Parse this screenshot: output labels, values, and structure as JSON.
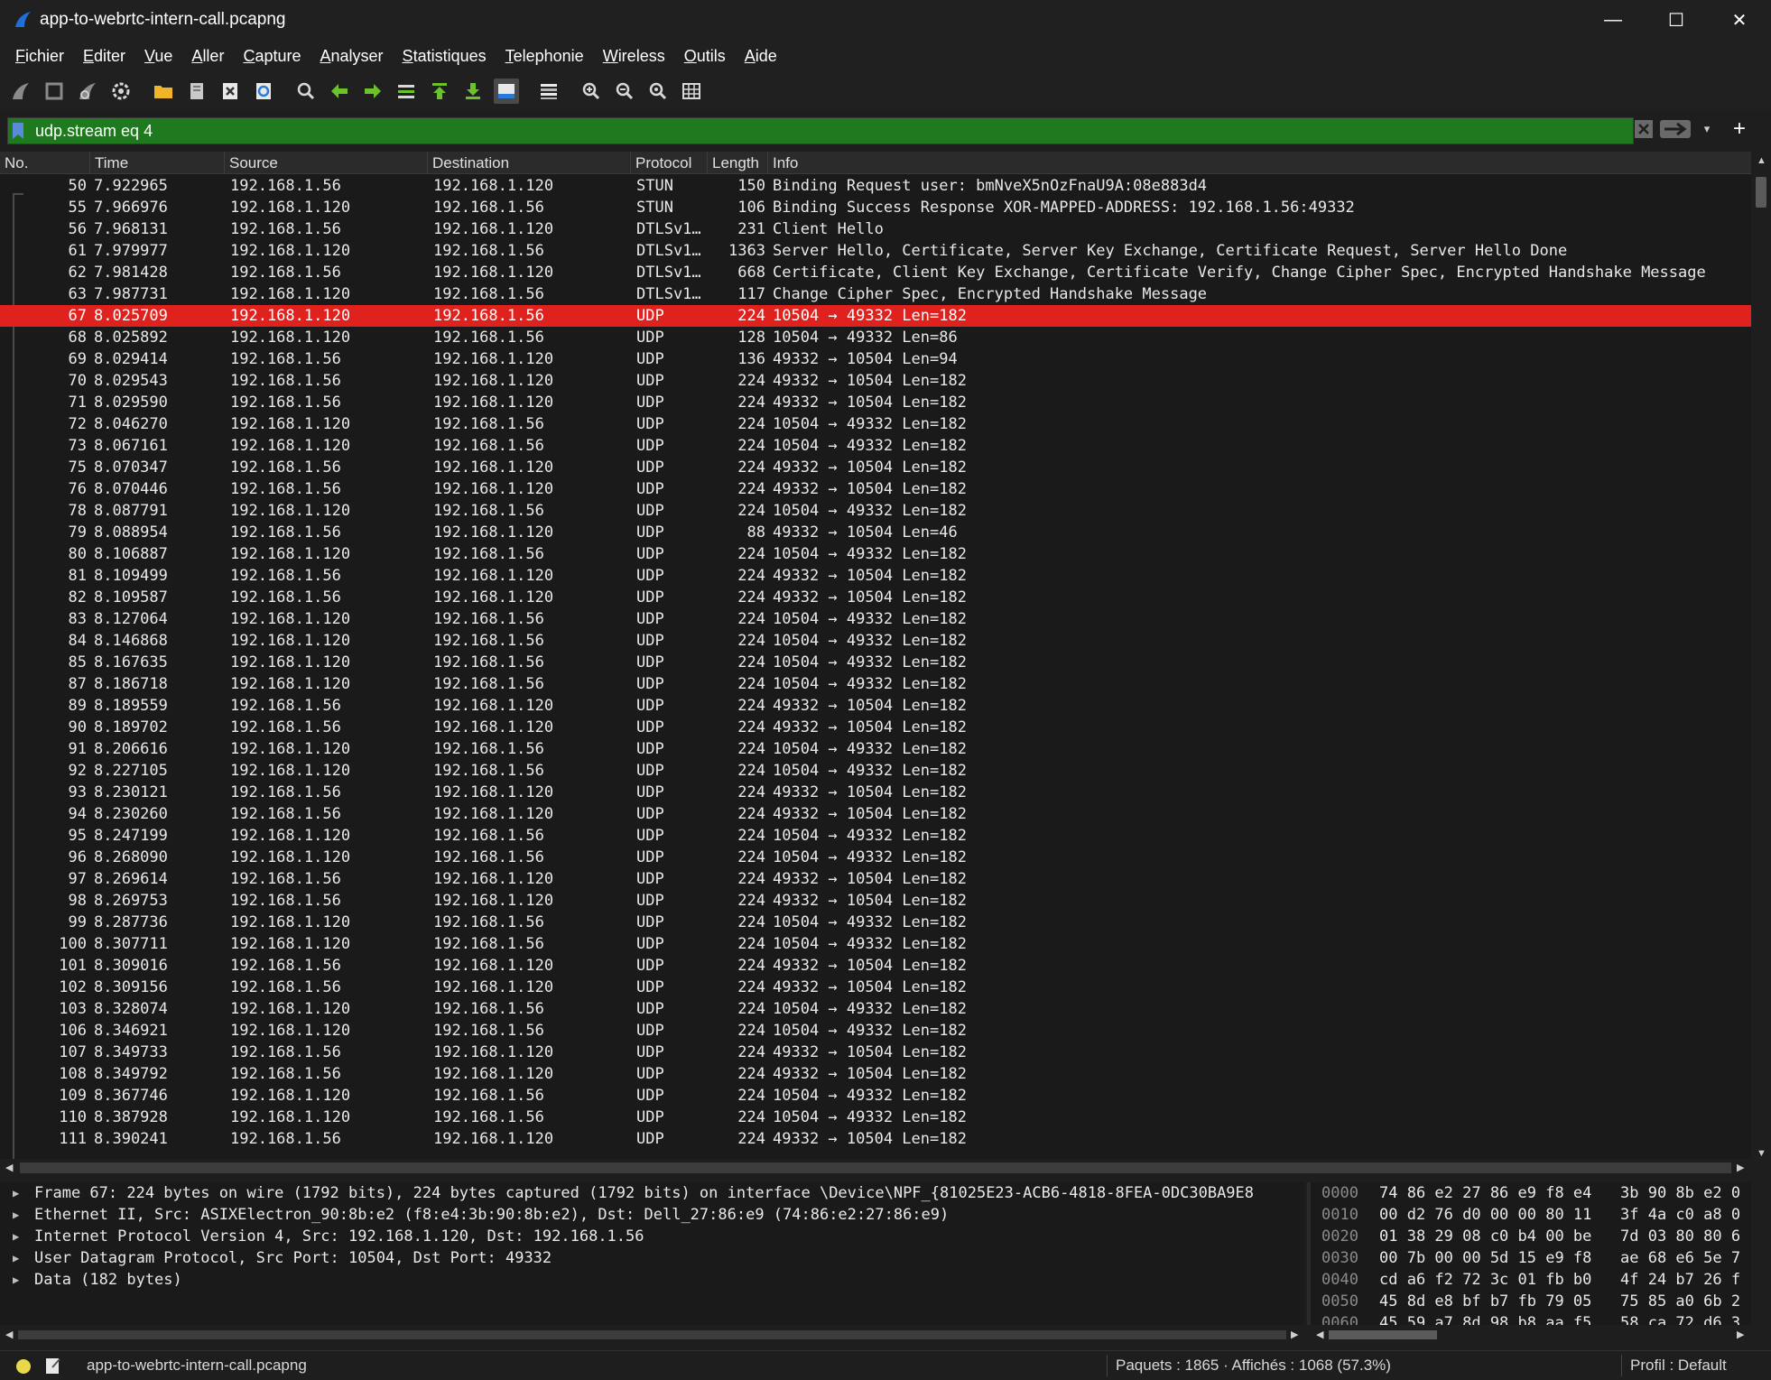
{
  "window": {
    "title": "app-to-webrtc-intern-call.pcapng",
    "controls": {
      "minimize": "—",
      "maximize": "☐",
      "close": "✕"
    }
  },
  "menu": [
    {
      "first": "F",
      "rest": "ichier"
    },
    {
      "first": "E",
      "rest": "diter"
    },
    {
      "first": "V",
      "rest": "ue"
    },
    {
      "first": "A",
      "rest": "ller"
    },
    {
      "first": "C",
      "rest": "apture"
    },
    {
      "first": "A",
      "rest": "nalyser"
    },
    {
      "first": "S",
      "rest": "tatistiques"
    },
    {
      "first": "T",
      "rest": "elephonie"
    },
    {
      "first": "W",
      "rest": "ireless"
    },
    {
      "first": "O",
      "rest": "utils"
    },
    {
      "first": "A",
      "rest": "ide"
    }
  ],
  "toolbar": [
    "shark-fin-start-icon",
    "stop-square-icon",
    "shark-fin-restart-icon",
    "capture-options-gear-icon",
    "open-folder-icon",
    "file-save-icon",
    "close-file-icon",
    "reload-icon",
    "find-packet-icon",
    "go-back-icon",
    "go-forward-icon",
    "go-to-packet-icon",
    "first-packet-icon",
    "last-packet-icon",
    "autoscroll-icon",
    "colorize-icon",
    "zoom-in-icon",
    "zoom-out-icon",
    "zoom-normal-icon",
    "resize-columns-icon"
  ],
  "filter": {
    "value": "udp.stream eq 4",
    "bg": "#1f7a1f",
    "add_label": "+",
    "drop_label": "▾"
  },
  "columns": [
    "No.",
    "Time",
    "Source",
    "Destination",
    "Protocol",
    "Length",
    "Info"
  ],
  "packets": [
    {
      "no": "50",
      "time": "7.922965",
      "src": "192.168.1.56",
      "dst": "192.168.1.120",
      "proto": "STUN",
      "len": "150",
      "info": "Binding Request user: bmNveX5nOzFnaU9A:08e883d4"
    },
    {
      "no": "55",
      "time": "7.966976",
      "src": "192.168.1.120",
      "dst": "192.168.1.56",
      "proto": "STUN",
      "len": "106",
      "info": "Binding Success Response XOR-MAPPED-ADDRESS: 192.168.1.56:49332"
    },
    {
      "no": "56",
      "time": "7.968131",
      "src": "192.168.1.56",
      "dst": "192.168.1.120",
      "proto": "DTLSv1…",
      "len": "231",
      "info": "Client Hello"
    },
    {
      "no": "61",
      "time": "7.979977",
      "src": "192.168.1.120",
      "dst": "192.168.1.56",
      "proto": "DTLSv1…",
      "len": "1363",
      "info": "Server Hello, Certificate, Server Key Exchange, Certificate Request, Server Hello Done"
    },
    {
      "no": "62",
      "time": "7.981428",
      "src": "192.168.1.56",
      "dst": "192.168.1.120",
      "proto": "DTLSv1…",
      "len": "668",
      "info": "Certificate, Client Key Exchange, Certificate Verify, Change Cipher Spec, Encrypted Handshake Message"
    },
    {
      "no": "63",
      "time": "7.987731",
      "src": "192.168.1.120",
      "dst": "192.168.1.56",
      "proto": "DTLSv1…",
      "len": "117",
      "info": "Change Cipher Spec, Encrypted Handshake Message"
    },
    {
      "no": "67",
      "time": "8.025709",
      "src": "192.168.1.120",
      "dst": "192.168.1.56",
      "proto": "UDP",
      "len": "224",
      "info": "10504 → 49332 Len=182",
      "selected": true
    },
    {
      "no": "68",
      "time": "8.025892",
      "src": "192.168.1.120",
      "dst": "192.168.1.56",
      "proto": "UDP",
      "len": "128",
      "info": "10504 → 49332 Len=86"
    },
    {
      "no": "69",
      "time": "8.029414",
      "src": "192.168.1.56",
      "dst": "192.168.1.120",
      "proto": "UDP",
      "len": "136",
      "info": "49332 → 10504 Len=94"
    },
    {
      "no": "70",
      "time": "8.029543",
      "src": "192.168.1.56",
      "dst": "192.168.1.120",
      "proto": "UDP",
      "len": "224",
      "info": "49332 → 10504 Len=182"
    },
    {
      "no": "71",
      "time": "8.029590",
      "src": "192.168.1.56",
      "dst": "192.168.1.120",
      "proto": "UDP",
      "len": "224",
      "info": "49332 → 10504 Len=182"
    },
    {
      "no": "72",
      "time": "8.046270",
      "src": "192.168.1.120",
      "dst": "192.168.1.56",
      "proto": "UDP",
      "len": "224",
      "info": "10504 → 49332 Len=182"
    },
    {
      "no": "73",
      "time": "8.067161",
      "src": "192.168.1.120",
      "dst": "192.168.1.56",
      "proto": "UDP",
      "len": "224",
      "info": "10504 → 49332 Len=182"
    },
    {
      "no": "75",
      "time": "8.070347",
      "src": "192.168.1.56",
      "dst": "192.168.1.120",
      "proto": "UDP",
      "len": "224",
      "info": "49332 → 10504 Len=182"
    },
    {
      "no": "76",
      "time": "8.070446",
      "src": "192.168.1.56",
      "dst": "192.168.1.120",
      "proto": "UDP",
      "len": "224",
      "info": "49332 → 10504 Len=182"
    },
    {
      "no": "78",
      "time": "8.087791",
      "src": "192.168.1.120",
      "dst": "192.168.1.56",
      "proto": "UDP",
      "len": "224",
      "info": "10504 → 49332 Len=182"
    },
    {
      "no": "79",
      "time": "8.088954",
      "src": "192.168.1.56",
      "dst": "192.168.1.120",
      "proto": "UDP",
      "len": "88",
      "info": "49332 → 10504 Len=46"
    },
    {
      "no": "80",
      "time": "8.106887",
      "src": "192.168.1.120",
      "dst": "192.168.1.56",
      "proto": "UDP",
      "len": "224",
      "info": "10504 → 49332 Len=182"
    },
    {
      "no": "81",
      "time": "8.109499",
      "src": "192.168.1.56",
      "dst": "192.168.1.120",
      "proto": "UDP",
      "len": "224",
      "info": "49332 → 10504 Len=182"
    },
    {
      "no": "82",
      "time": "8.109587",
      "src": "192.168.1.56",
      "dst": "192.168.1.120",
      "proto": "UDP",
      "len": "224",
      "info": "49332 → 10504 Len=182"
    },
    {
      "no": "83",
      "time": "8.127064",
      "src": "192.168.1.120",
      "dst": "192.168.1.56",
      "proto": "UDP",
      "len": "224",
      "info": "10504 → 49332 Len=182"
    },
    {
      "no": "84",
      "time": "8.146868",
      "src": "192.168.1.120",
      "dst": "192.168.1.56",
      "proto": "UDP",
      "len": "224",
      "info": "10504 → 49332 Len=182"
    },
    {
      "no": "85",
      "time": "8.167635",
      "src": "192.168.1.120",
      "dst": "192.168.1.56",
      "proto": "UDP",
      "len": "224",
      "info": "10504 → 49332 Len=182"
    },
    {
      "no": "87",
      "time": "8.186718",
      "src": "192.168.1.120",
      "dst": "192.168.1.56",
      "proto": "UDP",
      "len": "224",
      "info": "10504 → 49332 Len=182"
    },
    {
      "no": "89",
      "time": "8.189559",
      "src": "192.168.1.56",
      "dst": "192.168.1.120",
      "proto": "UDP",
      "len": "224",
      "info": "49332 → 10504 Len=182"
    },
    {
      "no": "90",
      "time": "8.189702",
      "src": "192.168.1.56",
      "dst": "192.168.1.120",
      "proto": "UDP",
      "len": "224",
      "info": "49332 → 10504 Len=182"
    },
    {
      "no": "91",
      "time": "8.206616",
      "src": "192.168.1.120",
      "dst": "192.168.1.56",
      "proto": "UDP",
      "len": "224",
      "info": "10504 → 49332 Len=182"
    },
    {
      "no": "92",
      "time": "8.227105",
      "src": "192.168.1.120",
      "dst": "192.168.1.56",
      "proto": "UDP",
      "len": "224",
      "info": "10504 → 49332 Len=182"
    },
    {
      "no": "93",
      "time": "8.230121",
      "src": "192.168.1.56",
      "dst": "192.168.1.120",
      "proto": "UDP",
      "len": "224",
      "info": "49332 → 10504 Len=182"
    },
    {
      "no": "94",
      "time": "8.230260",
      "src": "192.168.1.56",
      "dst": "192.168.1.120",
      "proto": "UDP",
      "len": "224",
      "info": "49332 → 10504 Len=182"
    },
    {
      "no": "95",
      "time": "8.247199",
      "src": "192.168.1.120",
      "dst": "192.168.1.56",
      "proto": "UDP",
      "len": "224",
      "info": "10504 → 49332 Len=182"
    },
    {
      "no": "96",
      "time": "8.268090",
      "src": "192.168.1.120",
      "dst": "192.168.1.56",
      "proto": "UDP",
      "len": "224",
      "info": "10504 → 49332 Len=182"
    },
    {
      "no": "97",
      "time": "8.269614",
      "src": "192.168.1.56",
      "dst": "192.168.1.120",
      "proto": "UDP",
      "len": "224",
      "info": "49332 → 10504 Len=182"
    },
    {
      "no": "98",
      "time": "8.269753",
      "src": "192.168.1.56",
      "dst": "192.168.1.120",
      "proto": "UDP",
      "len": "224",
      "info": "49332 → 10504 Len=182"
    },
    {
      "no": "99",
      "time": "8.287736",
      "src": "192.168.1.120",
      "dst": "192.168.1.56",
      "proto": "UDP",
      "len": "224",
      "info": "10504 → 49332 Len=182"
    },
    {
      "no": "100",
      "time": "8.307711",
      "src": "192.168.1.120",
      "dst": "192.168.1.56",
      "proto": "UDP",
      "len": "224",
      "info": "10504 → 49332 Len=182"
    },
    {
      "no": "101",
      "time": "8.309016",
      "src": "192.168.1.56",
      "dst": "192.168.1.120",
      "proto": "UDP",
      "len": "224",
      "info": "49332 → 10504 Len=182"
    },
    {
      "no": "102",
      "time": "8.309156",
      "src": "192.168.1.56",
      "dst": "192.168.1.120",
      "proto": "UDP",
      "len": "224",
      "info": "49332 → 10504 Len=182"
    },
    {
      "no": "103",
      "time": "8.328074",
      "src": "192.168.1.120",
      "dst": "192.168.1.56",
      "proto": "UDP",
      "len": "224",
      "info": "10504 → 49332 Len=182"
    },
    {
      "no": "106",
      "time": "8.346921",
      "src": "192.168.1.120",
      "dst": "192.168.1.56",
      "proto": "UDP",
      "len": "224",
      "info": "10504 → 49332 Len=182"
    },
    {
      "no": "107",
      "time": "8.349733",
      "src": "192.168.1.56",
      "dst": "192.168.1.120",
      "proto": "UDP",
      "len": "224",
      "info": "49332 → 10504 Len=182"
    },
    {
      "no": "108",
      "time": "8.349792",
      "src": "192.168.1.56",
      "dst": "192.168.1.120",
      "proto": "UDP",
      "len": "224",
      "info": "49332 → 10504 Len=182"
    },
    {
      "no": "109",
      "time": "8.367746",
      "src": "192.168.1.120",
      "dst": "192.168.1.56",
      "proto": "UDP",
      "len": "224",
      "info": "10504 → 49332 Len=182"
    },
    {
      "no": "110",
      "time": "8.387928",
      "src": "192.168.1.120",
      "dst": "192.168.1.56",
      "proto": "UDP",
      "len": "224",
      "info": "10504 → 49332 Len=182"
    },
    {
      "no": "111",
      "time": "8.390241",
      "src": "192.168.1.56",
      "dst": "192.168.1.120",
      "proto": "UDP",
      "len": "224",
      "info": "49332 → 10504 Len=182"
    }
  ],
  "details": [
    "Frame 67: 224 bytes on wire (1792 bits), 224 bytes captured (1792 bits) on interface \\Device\\NPF_{81025E23-ACB6-4818-8FEA-0DC30BA9E8",
    "Ethernet II, Src: ASIXElectron_90:8b:e2 (f8:e4:3b:90:8b:e2), Dst: Dell_27:86:e9 (74:86:e2:27:86:e9)",
    "Internet Protocol Version 4, Src: 192.168.1.120, Dst: 192.168.1.56",
    "User Datagram Protocol, Src Port: 10504, Dst Port: 49332",
    "Data (182 bytes)"
  ],
  "hex": [
    {
      "off": "0000",
      "b1": "74 86 e2 27 86 e9 f8 e4",
      "b2": "3b 90 8b e2 0"
    },
    {
      "off": "0010",
      "b1": "00 d2 76 d0 00 00 80 11",
      "b2": "3f 4a c0 a8 0"
    },
    {
      "off": "0020",
      "b1": "01 38 29 08 c0 b4 00 be",
      "b2": "7d 03 80 80 6"
    },
    {
      "off": "0030",
      "b1": "00 7b 00 00 5d 15 e9 f8",
      "b2": "ae 68 e6 5e 7"
    },
    {
      "off": "0040",
      "b1": "cd a6 f2 72 3c 01 fb b0",
      "b2": "4f 24 b7 26 f"
    },
    {
      "off": "0050",
      "b1": "45 8d e8 bf b7 fb 79 05",
      "b2": "75 85 a0 6b 2"
    },
    {
      "off": "0060",
      "b1": "45 59 a7 8d 98 b8 aa f5",
      "b2": "58 ca 72 d6 3"
    }
  ],
  "status": {
    "file": "app-to-webrtc-intern-call.pcapng",
    "stats": "Paquets : 1865 · Affichés : 1068 (57.3%)",
    "profile": "Profil : Default"
  },
  "colors": {
    "selected_row": "#e0221e",
    "filter_valid": "#1f7a1f",
    "background": "#1a1a1a"
  }
}
